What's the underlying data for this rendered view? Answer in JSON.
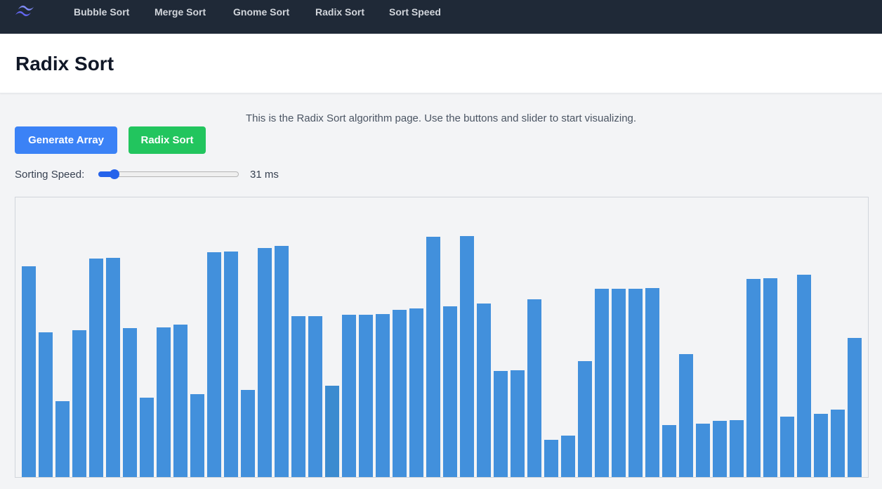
{
  "nav": {
    "logo_icon": "tailwind-wave-logo",
    "links": [
      "Bubble Sort",
      "Merge Sort",
      "Gnome Sort",
      "Radix Sort",
      "Sort Speed"
    ]
  },
  "header": {
    "title": "Radix Sort"
  },
  "main": {
    "intro": "This is the Radix Sort algorithm page. Use the buttons and slider to start visualizing.",
    "generate_label": "Generate Array",
    "sort_label": "Radix Sort",
    "speed_label": "Sorting Speed:",
    "speed_value": "31 ms",
    "speed_fraction": 0.08
  },
  "colors": {
    "nav_bg": "#1f2937",
    "bar": "#4290dc",
    "bar_active": "#3b8bd0",
    "generate_button": "#3b82f6",
    "sort_button": "#22c55e"
  },
  "chart_data": {
    "type": "bar",
    "highlighted_index": 18,
    "values": [
      300,
      206,
      108,
      209,
      311,
      312,
      212,
      113,
      213,
      217,
      118,
      320,
      321,
      124,
      326,
      329,
      229,
      229,
      130,
      231,
      231,
      232,
      238,
      240,
      342,
      243,
      343,
      247,
      151,
      152,
      253,
      53,
      59,
      165,
      268,
      268,
      268,
      269,
      74,
      175,
      76,
      80,
      81,
      282,
      283,
      86,
      288,
      90,
      96,
      198
    ],
    "ylim": [
      0,
      398
    ]
  }
}
